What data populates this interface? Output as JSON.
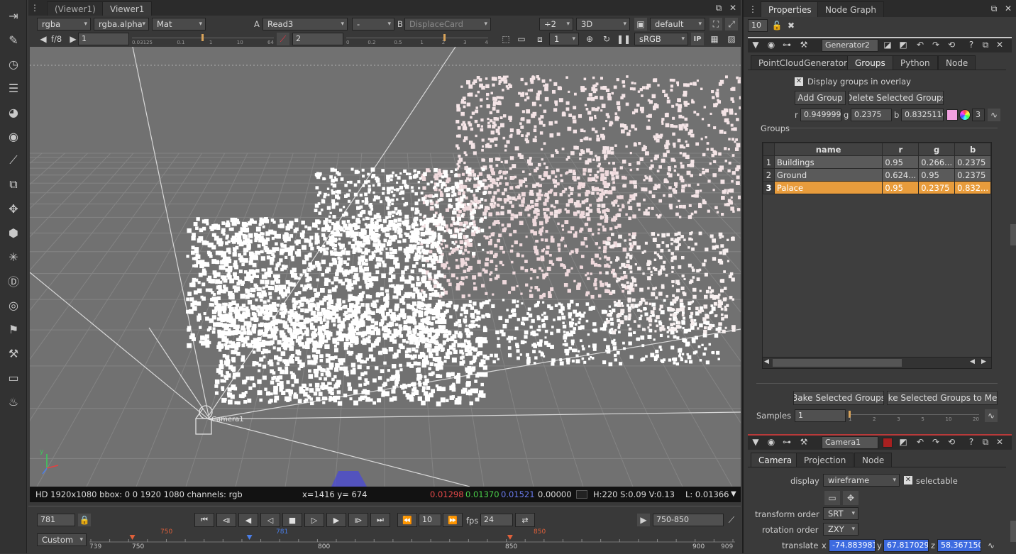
{
  "viewer": {
    "tabs": [
      "(Viewer1)",
      "Viewer1"
    ],
    "channels": "rgba",
    "alpha": "rgba.alpha",
    "matte": "Mat",
    "a_label": "A",
    "a_input": "Read3",
    "compare": "-",
    "b_label": "B",
    "b_input": "DisplaceCard",
    "proxy": "÷2",
    "view_mode": "3D",
    "lut": "default",
    "fstop": "f/8",
    "gain": "1",
    "gamma": "2",
    "frame_step": "1",
    "colorspace": "sRGB",
    "ip": "IP",
    "gain_ticks": [
      "0.03125",
      "0.1",
      "1",
      "10",
      "64"
    ],
    "gamma_ticks": [
      "0",
      "0.2",
      "0.5",
      "1",
      "2",
      "3",
      "4"
    ],
    "camera_label": "Camera1",
    "info": {
      "format": "HD 1920x1080 bbox: 0 0 1920 1080 channels: rgb",
      "coords": "x=1416 y= 674",
      "r": "0.01298",
      "g": "0.01370",
      "b": "0.01521",
      "a": "0.00000",
      "hsv": "H:220 S:0.09 V:0.13",
      "luma": "L: 0.01366"
    },
    "timeline": {
      "frame": "781",
      "skip": "10",
      "fps_label": "fps",
      "fps": "24",
      "range": "750-850",
      "range_mode": "Custom",
      "in": "750",
      "out": "850",
      "current": "781",
      "start": "739",
      "end": "909",
      "ticks": [
        "750",
        "800",
        "850",
        "900"
      ]
    }
  },
  "colors": {
    "accent_orange": "#e89c3c",
    "in_marker": "#e0603a",
    "current_marker": "#4a7ee8",
    "pink_swatch": "#f2a0e0"
  },
  "properties": {
    "tabs": [
      "Properties",
      "Node Graph"
    ],
    "max_panels": "10",
    "generator": {
      "name": "Generator2",
      "tabs": [
        "PointCloudGenerator",
        "Groups",
        "Python",
        "Node"
      ],
      "display_overlay": "Display groups in overlay",
      "add_group": "Add Group",
      "delete_groups": "Delete Selected Groups",
      "r_label": "r",
      "r_val": "0.9499999",
      "g_label": "g",
      "g_val": "0.2375",
      "b_label": "b",
      "b_val": "0.8325116",
      "count": "3",
      "groups_label": "Groups",
      "columns": [
        "name",
        "r",
        "g",
        "b"
      ],
      "rows": [
        {
          "idx": "1",
          "name": "Buildings",
          "r": "0.95",
          "g": "0.266...",
          "b": "0.2375"
        },
        {
          "idx": "2",
          "name": "Ground",
          "r": "0.624...",
          "g": "0.95",
          "b": "0.2375"
        },
        {
          "idx": "3",
          "name": "Palace",
          "r": "0.95",
          "g": "0.2375",
          "b": "0.832..."
        }
      ],
      "selected_row": 2,
      "bake_groups": "Bake Selected Groups",
      "bake_mesh": "ake Selected Groups to Mes",
      "samples_label": "Samples",
      "samples_val": "1",
      "samples_ticks": [
        "1",
        "2",
        "3",
        "5",
        "10",
        "20"
      ]
    },
    "camera": {
      "name": "Camera1",
      "tabs": [
        "Camera",
        "Projection",
        "Node"
      ],
      "display_label": "display",
      "display_val": "wireframe",
      "selectable": "selectable",
      "transform_label": "transform order",
      "transform_val": "SRT",
      "rotation_label": "rotation order",
      "rotation_val": "ZXY",
      "translate_label": "translate",
      "x_label": "x",
      "x_val": "-74.883981",
      "y_label": "y",
      "y_val": "67.817029",
      "z_label": "z",
      "z_val": "58.3671504"
    }
  }
}
